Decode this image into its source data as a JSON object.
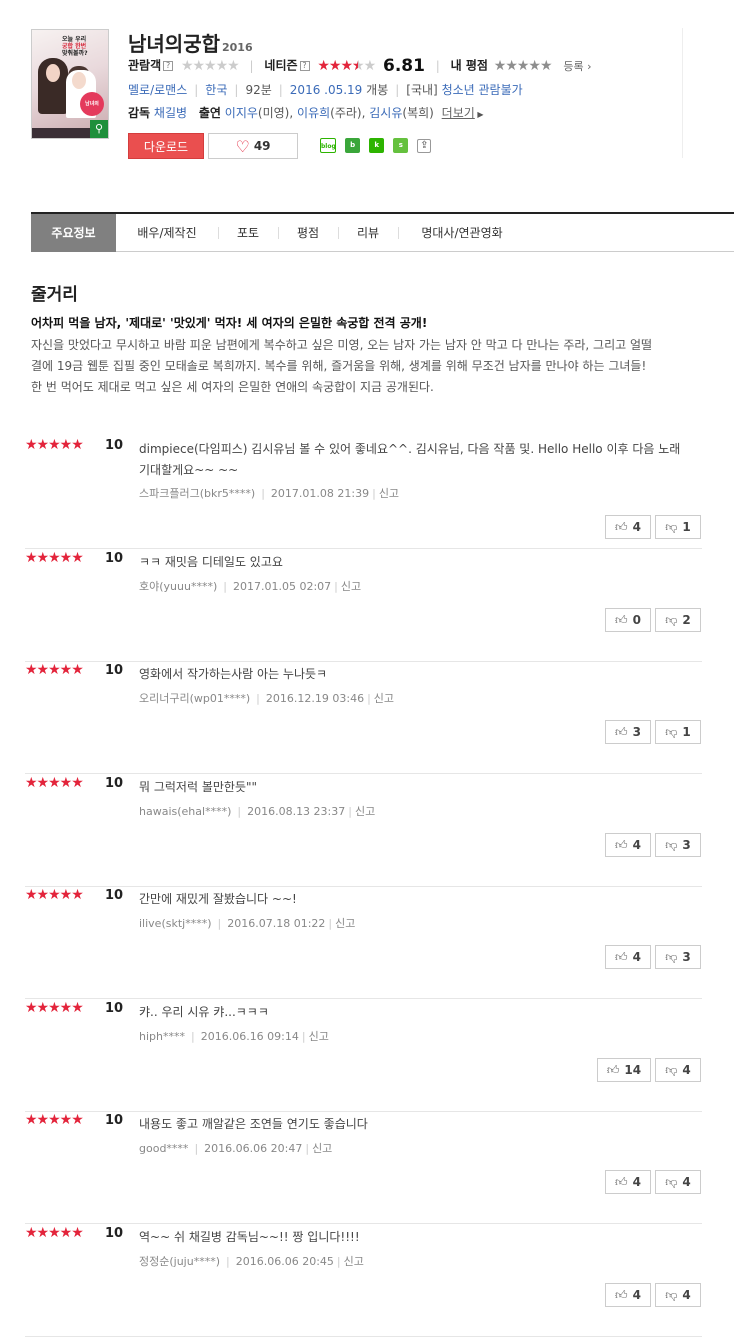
{
  "movie": {
    "poster_text_line1": "오늘 우리",
    "poster_text_line2": "궁합 한번",
    "poster_text_line3": "맞춰볼까?",
    "poster_badge": "남녀의",
    "title": "남녀의궁합",
    "year": "2016",
    "audience_label": "관람객",
    "netizen_label": "네티즌",
    "netizen_score": "6.81",
    "my_rating_label": "내 평점",
    "register_label": "등록",
    "genre": "멜로/로맨스",
    "country": "한국",
    "runtime": "92분",
    "release": "2016 .05.19",
    "release_suffix": "개봉",
    "rating_prefix": "[국내]",
    "rating": "청소년 관람불가",
    "director_label": "감독",
    "director": "채길병",
    "cast_label": "출연",
    "cast_1": "이지우",
    "cast_1_role": "(미영)",
    "cast_2": "이유희",
    "cast_2_role": "(주라)",
    "cast_3": "김시유",
    "cast_3_role": "(복희)",
    "more_label": "더보기",
    "download_label": "다운로드",
    "like_count": "49"
  },
  "share": {
    "blog": "blog",
    "band": "b",
    "kakao": "k",
    "story": "s"
  },
  "tabs": [
    "주요정보",
    "배우/제작진",
    "포토",
    "평점",
    "리뷰",
    "명대사/연관영화"
  ],
  "plot": {
    "heading": "줄거리",
    "tagline": "어차피 먹을 남자, '제대로' '맛있게' 먹자! 세 여자의 은밀한 속궁합 전격 공개!",
    "line1": "자신을 맛었다고 무시하고 바람 피운 남편에게 복수하고 싶은 미영, 오는 남자 가는 남자 안 막고 다 만나는 주라, 그리고 얼떨",
    "line2": "결에 19금 웹툰 집필 중인 모태솔로 복희까지. 복수를 위해, 즐거움을 위해, 생계를 위해 무조건 남자를 만나야 하는 그녀들!",
    "line3": "한 번 먹어도 제대로 먹고 싶은 세 여자의 은밀한 연애의 속궁합이 지금 공개된다."
  },
  "reviews": [
    {
      "stars": "★★★★★",
      "score": "10",
      "text": "dimpiece(다임피스) 김시유님 볼 수 있어 좋네요^^. 김시유님, 다음 작품 및. Hello Hello 이후 다음 노래 기대할게요~~ ~~",
      "user": "스파크플러그(bkr5****)",
      "date": "2017.01.08 21:39",
      "report": "신고",
      "up": "4",
      "down": "1"
    },
    {
      "stars": "★★★★★",
      "score": "10",
      "text": "ㅋㅋ 재밋음 디테일도 있고요",
      "user": "호야(yuuu****)",
      "date": "2017.01.05 02:07",
      "report": "신고",
      "up": "0",
      "down": "2"
    },
    {
      "stars": "★★★★★",
      "score": "10",
      "text": "영화에서 작가하는사람 아는 누나듯ㅋ",
      "user": "오리너구리(wp01****)",
      "date": "2016.12.19 03:46",
      "report": "신고",
      "up": "3",
      "down": "1"
    },
    {
      "stars": "★★★★★",
      "score": "10",
      "text": "뭐 그럭저럭 볼만한듯\"\"",
      "user": "hawais(ehal****)",
      "date": "2016.08.13 23:37",
      "report": "신고",
      "up": "4",
      "down": "3"
    },
    {
      "stars": "★★★★★",
      "score": "10",
      "text": "간만에 재밌게 잘봤습니다 ~~!",
      "user": "ilive(sktj****)",
      "date": "2016.07.18 01:22",
      "report": "신고",
      "up": "4",
      "down": "3"
    },
    {
      "stars": "★★★★★",
      "score": "10",
      "text": "캬.. 우리 시유 캬...ㅋㅋㅋ",
      "user": "hiph****",
      "date": "2016.06.16 09:14",
      "report": "신고",
      "up": "14",
      "down": "4"
    },
    {
      "stars": "★★★★★",
      "score": "10",
      "text": "내용도 좋고 깨알같은 조연들 연기도 좋습니다",
      "user": "good****",
      "date": "2016.06.06 20:47",
      "report": "신고",
      "up": "4",
      "down": "4"
    },
    {
      "stars": "★★★★★",
      "score": "10",
      "text": "역~~ 쉬 채길병 감독님~~!! 짱 입니다!!!!",
      "user": "정정순(juju****)",
      "date": "2016.06.06 20:45",
      "report": "신고",
      "up": "4",
      "down": "4"
    }
  ],
  "colors": {
    "accent_red": "#e3243b",
    "link_blue": "#3b6bb8",
    "download_red": "#ea4f4f",
    "tab_active": "#808080"
  },
  "icons": {
    "like": "heart-icon",
    "thumb_up": "thumb-up-icon",
    "thumb_down": "thumb-down-icon",
    "share": "share-icon",
    "zoom": "search-icon"
  }
}
